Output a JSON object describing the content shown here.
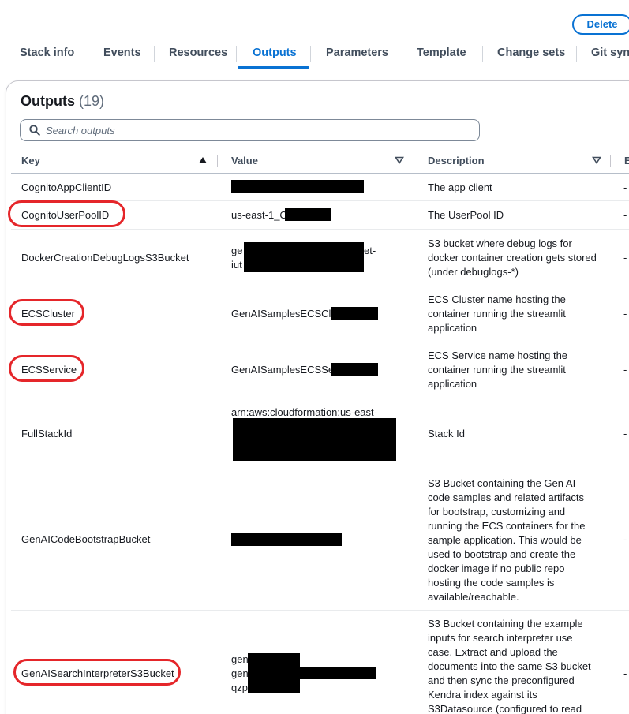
{
  "actions": {
    "delete_label": "Delete"
  },
  "tabs": [
    {
      "label": "Stack info",
      "active": false
    },
    {
      "label": "Events",
      "active": false
    },
    {
      "label": "Resources",
      "active": false
    },
    {
      "label": "Outputs",
      "active": true
    },
    {
      "label": "Parameters",
      "active": false
    },
    {
      "label": "Template",
      "active": false
    },
    {
      "label": "Change sets",
      "active": false
    },
    {
      "label": "Git sync",
      "active": false
    }
  ],
  "outputs": {
    "title": "Outputs",
    "count": "(19)",
    "search_placeholder": "Search outputs",
    "columns": [
      "Key",
      "Value",
      "Description",
      "E"
    ],
    "rows": [
      {
        "key": "CognitoAppClientID",
        "value": "",
        "description": "The app client",
        "extra": "-",
        "highlighted": false
      },
      {
        "key": "CognitoUserPoolID",
        "value": "us-east-1_C",
        "description": "The UserPool ID",
        "extra": "-",
        "highlighted": true
      },
      {
        "key": "DockerCreationDebugLogsS3Bucket",
        "value_lines": [
          "ge",
          "iut"
        ],
        "value_suffix": [
          "et-",
          ""
        ],
        "description": "S3 bucket where debug logs for docker container creation gets stored (under debuglogs-*)",
        "extra": "-",
        "highlighted": false
      },
      {
        "key": "ECSCluster",
        "value": "GenAISamplesECSClu",
        "description": "ECS Cluster name hosting the container running the streamlit application",
        "extra": "-",
        "highlighted": true
      },
      {
        "key": "ECSService",
        "value": "GenAISamplesECSSer",
        "description": "ECS Service name hosting the container running the streamlit application",
        "extra": "-",
        "highlighted": true
      },
      {
        "key": "FullStackId",
        "value": "arn:aws:cloudformation:us-east-",
        "description": "Stack Id",
        "extra": "-",
        "highlighted": false
      },
      {
        "key": "GenAICodeBootstrapBucket",
        "value": "",
        "description": "S3 Bucket containing the Gen AI code samples and related artifacts for bootstrap, customizing and running the ECS containers for the sample application. This would be used to bootstrap and create the docker image if no public repo hosting the code samples is available/reachable.",
        "extra": "-",
        "highlighted": false
      },
      {
        "key": "GenAISearchInterpreterS3Bucket",
        "value_lines": [
          "gen",
          "gen",
          "qzp"
        ],
        "description": "S3 Bucket containing the example inputs for search interpreter use case. Extract and upload the documents into the same S3 bucket and then sync the preconfigured Kendra index against its S3Datasource (configured to read",
        "extra": "-",
        "highlighted": true
      }
    ]
  },
  "colors": {
    "accent": "#0972d3",
    "annotation": "#e5262a",
    "redaction": "#000000"
  },
  "icons": [
    "search-icon",
    "sort-ascending-icon",
    "sort-descending-icon"
  ]
}
